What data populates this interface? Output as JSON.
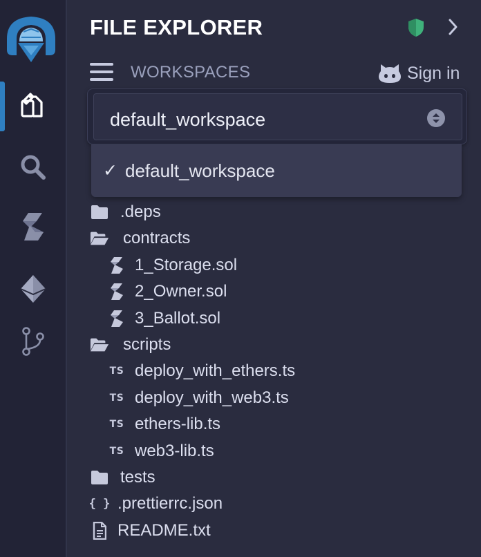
{
  "panel": {
    "title": "FILE EXPLORER"
  },
  "workspaces": {
    "label": "WORKSPACES",
    "sign_in": "Sign in",
    "selected": "default_workspace",
    "check": "✓",
    "options": [
      "default_workspace"
    ]
  },
  "tree": {
    "deps": ".deps",
    "contracts": "contracts",
    "contract_files": [
      "1_Storage.sol",
      "2_Owner.sol",
      "3_Ballot.sol"
    ],
    "scripts": "scripts",
    "script_files": [
      "deploy_with_ethers.ts",
      "deploy_with_web3.ts",
      "ethers-lib.ts",
      "web3-lib.ts"
    ],
    "ts_badge": "TS",
    "tests": "tests",
    "prettierrc": ".prettierrc.json",
    "readme": "README.txt"
  },
  "icons": {
    "activity": [
      "file-explorer-icon",
      "search-icon",
      "solidity-compiler-icon",
      "deploy-run-icon",
      "git-icon"
    ],
    "shield": "shield-icon",
    "chevron": "chevron-right-icon"
  },
  "colors": {
    "background": "#2a2c3f",
    "sidebar": "#222336",
    "accent": "#2f7fc1",
    "shield": "#3fb17b",
    "text": "#e4e6f0",
    "muted": "#9aa0bc"
  }
}
